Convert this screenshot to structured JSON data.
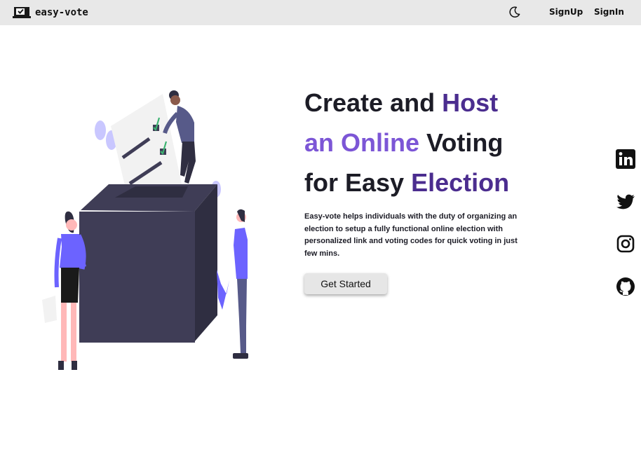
{
  "navbar": {
    "brand": "easy-vote",
    "brand_icon": "ballot-laptop-icon",
    "theme_icon": "moon-icon",
    "signup_label": "SignUp",
    "signin_label": "SignIn"
  },
  "hero": {
    "title_part1": "Create and",
    "title_part2": "Host",
    "title_part3": "an Online",
    "title_part4": "Voting",
    "title_part5": "for Easy",
    "title_part6": "Election",
    "description": "Easy-vote helps individuals with the duty of organizing an election to setup a fully functional online election with personalized link and voting codes for quick voting in just few mins.",
    "cta_label": "Get Started"
  },
  "social": [
    "linkedin-icon",
    "twitter-icon",
    "instagram-icon",
    "github-icon"
  ],
  "colors": {
    "navbar_bg": "#e8e8e8",
    "accent_dark": "#4b2d8f",
    "accent_light": "#7c56d6",
    "text": "#1c1c26",
    "box": "#3f3d56",
    "figure_shirt": "#6c63ff",
    "skin": "#ffb8b8",
    "check": "#3cb371"
  }
}
